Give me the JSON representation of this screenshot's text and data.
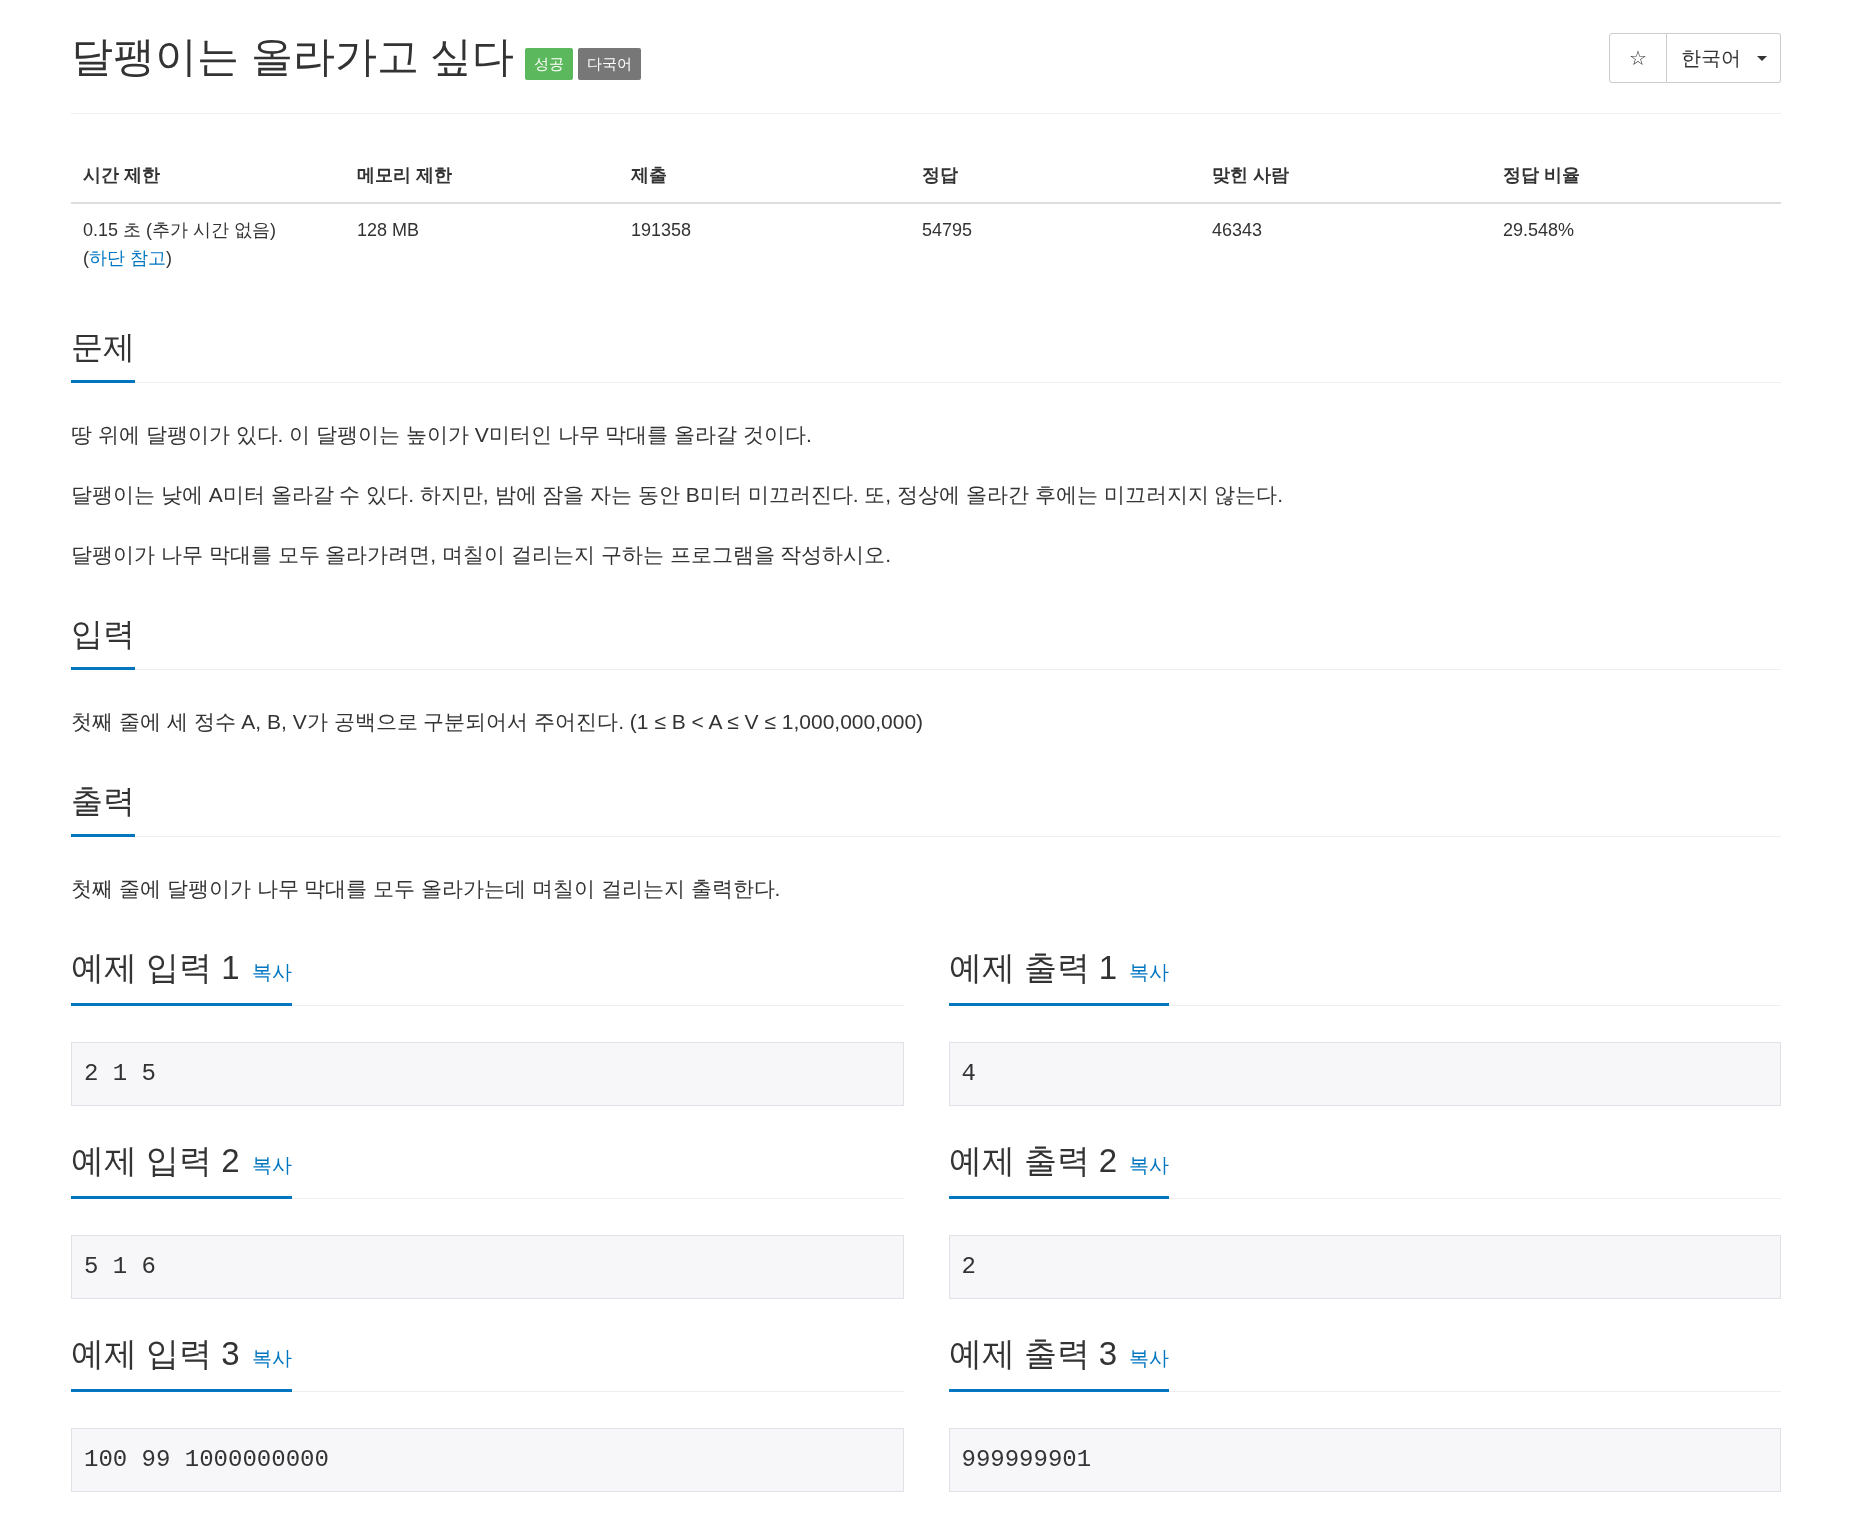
{
  "title": "달팽이는 올라가고 싶다",
  "badges": [
    {
      "label": "성공",
      "color": "#5cb85c"
    },
    {
      "label": "다국어",
      "color": "#777777"
    }
  ],
  "toolbar": {
    "star": "☆",
    "language": "한국어"
  },
  "info_table": {
    "columns": [
      "시간 제한",
      "메모리 제한",
      "제출",
      "정답",
      "맞힌 사람",
      "정답 비율"
    ],
    "rows": [
      [
        [
          {
            "text": "0.15 초 (추가 시간 없음) ("
          },
          {
            "text": "하단 참고",
            "link": true
          },
          {
            "text": ")"
          }
        ],
        [
          {
            "text": "128 MB"
          }
        ],
        [
          {
            "text": "191358"
          }
        ],
        [
          {
            "text": "54795"
          }
        ],
        [
          {
            "text": "46343"
          }
        ],
        [
          {
            "text": "29.548%"
          }
        ]
      ]
    ]
  },
  "sections": [
    {
      "heading": "문제",
      "paragraphs": [
        "땅 위에 달팽이가 있다. 이 달팽이는 높이가 V미터인 나무 막대를 올라갈 것이다.",
        "달팽이는 낮에 A미터 올라갈 수 있다. 하지만, 밤에 잠을 자는 동안 B미터 미끄러진다. 또, 정상에 올라간 후에는 미끄러지지 않는다.",
        "달팽이가 나무 막대를 모두 올라가려면, 며칠이 걸리는지 구하는 프로그램을 작성하시오."
      ]
    },
    {
      "heading": "입력",
      "paragraphs": [
        "첫째 줄에 세 정수 A, B, V가 공백으로 구분되어서 주어진다. (1 ≤ B < A ≤ V ≤ 1,000,000,000)"
      ]
    },
    {
      "heading": "출력",
      "paragraphs": [
        "첫째 줄에 달팽이가 나무 막대를 모두 올라가는데 며칠이 걸리는지 출력한다."
      ]
    }
  ],
  "samples": [
    {
      "heading": "예제 입력 1",
      "copy": "복사",
      "data": "2 1 5"
    },
    {
      "heading": "예제 출력 1",
      "copy": "복사",
      "data": "4"
    },
    {
      "heading": "예제 입력 2",
      "copy": "복사",
      "data": "5 1 6"
    },
    {
      "heading": "예제 출력 2",
      "copy": "복사",
      "data": "2"
    },
    {
      "heading": "예제 입력 3",
      "copy": "복사",
      "data": "100 99 1000000000"
    },
    {
      "heading": "예제 출력 3",
      "copy": "복사",
      "data": "999999901"
    }
  ]
}
